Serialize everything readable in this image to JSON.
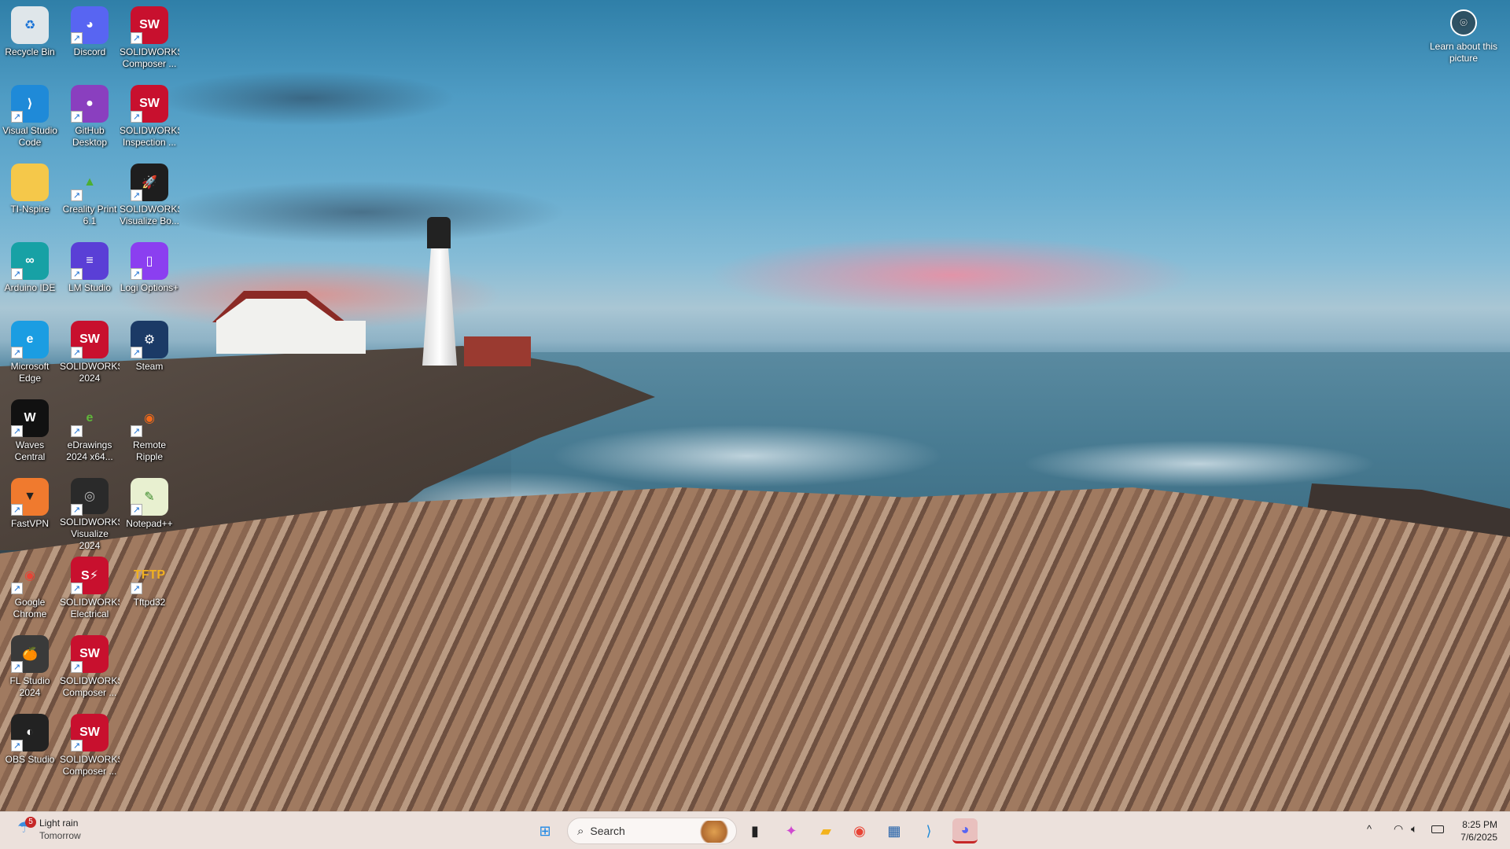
{
  "desktop": {
    "icons": [
      {
        "label": "Recycle Bin",
        "icon": "recycle-bin-icon",
        "glyph": "♻",
        "color": "#dfe6ea",
        "fg": "#1a73d6",
        "shortcut": false
      },
      {
        "label": "Discord",
        "icon": "discord-icon",
        "glyph": "◕",
        "color": "#5865f2",
        "fg": "#ffffff",
        "shortcut": true
      },
      {
        "label": "SOLIDWORKS Composer ...",
        "icon": "solidworks-composer-icon",
        "glyph": "SW",
        "color": "#c8102e",
        "fg": "#ffffff",
        "shortcut": true
      },
      {
        "label": "Visual Studio Code",
        "icon": "vscode-icon",
        "glyph": "⟩",
        "color": "#1f8ad8",
        "fg": "#ffffff",
        "shortcut": true
      },
      {
        "label": "GitHub Desktop",
        "icon": "github-desktop-icon",
        "glyph": "●",
        "color": "#8a3fbf",
        "fg": "#ffffff",
        "shortcut": true
      },
      {
        "label": "SOLIDWORKS Inspection ...",
        "icon": "solidworks-inspection-icon",
        "glyph": "SW",
        "color": "#c8102e",
        "fg": "#ffffff",
        "shortcut": true
      },
      {
        "label": "TI-Nspire",
        "icon": "folder-icon",
        "glyph": "",
        "color": "#f5c84a",
        "fg": "#ffffff",
        "shortcut": false
      },
      {
        "label": "Creality Print 6.1",
        "icon": "creality-print-icon",
        "glyph": "▲",
        "color": "transparent",
        "fg": "#4caf32",
        "shortcut": true
      },
      {
        "label": "SOLIDWORKS Visualize Bo...",
        "icon": "solidworks-visualize-boost-icon",
        "glyph": "🚀",
        "color": "#1e1e1e",
        "fg": "#ffffff",
        "shortcut": true
      },
      {
        "label": "Arduino IDE",
        "icon": "arduino-icon",
        "glyph": "∞",
        "color": "#17a1a5",
        "fg": "#ffffff",
        "shortcut": true
      },
      {
        "label": "LM Studio",
        "icon": "lm-studio-icon",
        "glyph": "≡",
        "color": "#5a3fd6",
        "fg": "#ffffff",
        "shortcut": true
      },
      {
        "label": "Logi Options+",
        "icon": "logi-options-icon",
        "glyph": "▯",
        "color": "#8b3ff0",
        "fg": "#ffffff",
        "shortcut": true
      },
      {
        "label": "Microsoft Edge",
        "icon": "edge-icon",
        "glyph": "e",
        "color": "#1b9de2",
        "fg": "#ffffff",
        "shortcut": true
      },
      {
        "label": "SOLIDWORKS 2024",
        "icon": "solidworks-icon",
        "glyph": "SW",
        "color": "#c8102e",
        "fg": "#ffffff",
        "shortcut": true
      },
      {
        "label": "Steam",
        "icon": "steam-icon",
        "glyph": "⚙",
        "color": "#1b3a66",
        "fg": "#ffffff",
        "shortcut": true
      },
      {
        "label": "Waves Central",
        "icon": "waves-central-icon",
        "glyph": "W",
        "color": "#111111",
        "fg": "#ffffff",
        "shortcut": true
      },
      {
        "label": "eDrawings 2024 x64...",
        "icon": "edrawings-icon",
        "glyph": "e",
        "color": "transparent",
        "fg": "#5fb83a",
        "shortcut": true
      },
      {
        "label": "Remote Ripple",
        "icon": "remote-ripple-icon",
        "glyph": "◉",
        "color": "transparent",
        "fg": "#f26a1b",
        "shortcut": true
      },
      {
        "label": "FastVPN",
        "icon": "fastvpn-icon",
        "glyph": "▼",
        "color": "#f07a2e",
        "fg": "#222222",
        "shortcut": true
      },
      {
        "label": "SOLIDWORKS Visualize 2024",
        "icon": "solidworks-visualize-icon",
        "glyph": "◎",
        "color": "#2a2a2a",
        "fg": "#bbbbbb",
        "shortcut": true
      },
      {
        "label": "Notepad++",
        "icon": "notepad-plus-plus-icon",
        "glyph": "✎",
        "color": "#e8f0d0",
        "fg": "#3a8a2a",
        "shortcut": true
      },
      {
        "label": "Google Chrome",
        "icon": "chrome-icon",
        "glyph": "◉",
        "color": "transparent",
        "fg": "#e84335",
        "shortcut": true
      },
      {
        "label": "SOLIDWORKS Electrical",
        "icon": "solidworks-electrical-icon",
        "glyph": "S⚡",
        "color": "#c8102e",
        "fg": "#ffffff",
        "shortcut": true
      },
      {
        "label": "Tftpd32",
        "icon": "tftpd32-icon",
        "glyph": "TFTP",
        "color": "transparent",
        "fg": "#f0b020",
        "shortcut": true
      },
      {
        "label": "FL Studio 2024",
        "icon": "fl-studio-icon",
        "glyph": "🍊",
        "color": "#3a3a3a",
        "fg": "#f08a20",
        "shortcut": true
      },
      {
        "label": "SOLIDWORKS Composer ...",
        "icon": "solidworks-composer-player-icon",
        "glyph": "SW",
        "color": "#c8102e",
        "fg": "#ffffff",
        "shortcut": true
      },
      {
        "label": "OBS Studio",
        "icon": "obs-studio-icon",
        "glyph": "◐",
        "color": "#222222",
        "fg": "#ffffff",
        "shortcut": true
      },
      {
        "label": "SOLIDWORKS Composer ...",
        "icon": "solidworks-composer-sync-icon",
        "glyph": "SW",
        "color": "#c8102e",
        "fg": "#ffffff",
        "shortcut": true
      }
    ],
    "layout_columns": [
      0,
      1,
      2,
      0,
      1,
      2,
      0,
      1,
      2,
      0,
      1,
      2,
      0,
      1,
      2,
      0,
      1,
      2,
      0,
      1,
      2,
      0,
      1,
      2,
      0,
      1,
      0,
      1
    ],
    "layout_rows": [
      0,
      0,
      0,
      1,
      1,
      1,
      2,
      2,
      2,
      3,
      3,
      3,
      4,
      4,
      4,
      5,
      5,
      5,
      6,
      6,
      6,
      7,
      7,
      7,
      8,
      8,
      9,
      9
    ],
    "learn_about_picture": "Learn about this picture"
  },
  "taskbar": {
    "weather": {
      "badge": "5",
      "condition": "Light rain",
      "when": "Tomorrow"
    },
    "search_placeholder": "Search",
    "pinned": [
      {
        "name": "start-button",
        "icon": "windows-logo-icon",
        "glyph": "⊞",
        "color": "#1e88e5"
      },
      {
        "name": "task-view-button",
        "icon": "task-view-icon",
        "glyph": "▮",
        "color": "#222222"
      },
      {
        "name": "copilot-button",
        "icon": "copilot-icon",
        "glyph": "✦",
        "color": "#d04ad0"
      },
      {
        "name": "file-explorer-button",
        "icon": "folder-icon",
        "glyph": "▰",
        "color": "#f3b21b"
      },
      {
        "name": "chrome-button",
        "icon": "chrome-icon",
        "glyph": "◉",
        "color": "#e84335"
      },
      {
        "name": "microsoft-store-button",
        "icon": "store-icon",
        "glyph": "▦",
        "color": "#1e5ea8"
      },
      {
        "name": "vscode-button",
        "icon": "vscode-icon",
        "glyph": "⟩",
        "color": "#1f8ad8"
      },
      {
        "name": "discord-button",
        "icon": "discord-icon",
        "glyph": "◕",
        "color": "#5865f2"
      }
    ],
    "tray": {
      "chevron": "^",
      "wifi": "wifi-icon",
      "volume": "speaker-icon",
      "battery": "battery-icon"
    },
    "time": "8:25 PM",
    "date": "7/6/2025"
  }
}
